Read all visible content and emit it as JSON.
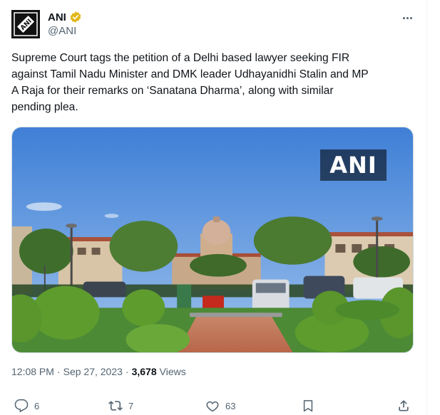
{
  "author": {
    "display_name": "ANI",
    "handle": "@ANI",
    "avatar_text": "ANI",
    "verified": true
  },
  "tweet": {
    "text": "Supreme Court tags the petition of a Delhi based lawyer seeking FIR\nagainst Tamil Nadu Minister and DMK leader Udhayanidhi Stalin and MP\nA Raja for their remarks on ‘Sanatana Dharma’, along with similar\npending plea.",
    "media_watermark": "ANI"
  },
  "meta": {
    "time": "12:08 PM",
    "separator": "·",
    "date": "Sep 27, 2023",
    "separator2": "·",
    "views_count": "3,678",
    "views_label": "Views"
  },
  "actions": {
    "replies": "6",
    "reposts": "7",
    "likes": "63",
    "icons": [
      "reply-icon",
      "repost-icon",
      "like-icon",
      "bookmark-icon",
      "share-icon"
    ]
  },
  "colors": {
    "text_primary": "#0f1419",
    "text_secondary": "#536471",
    "verified_gold": "#e2b719",
    "border": "#cfd9de"
  }
}
